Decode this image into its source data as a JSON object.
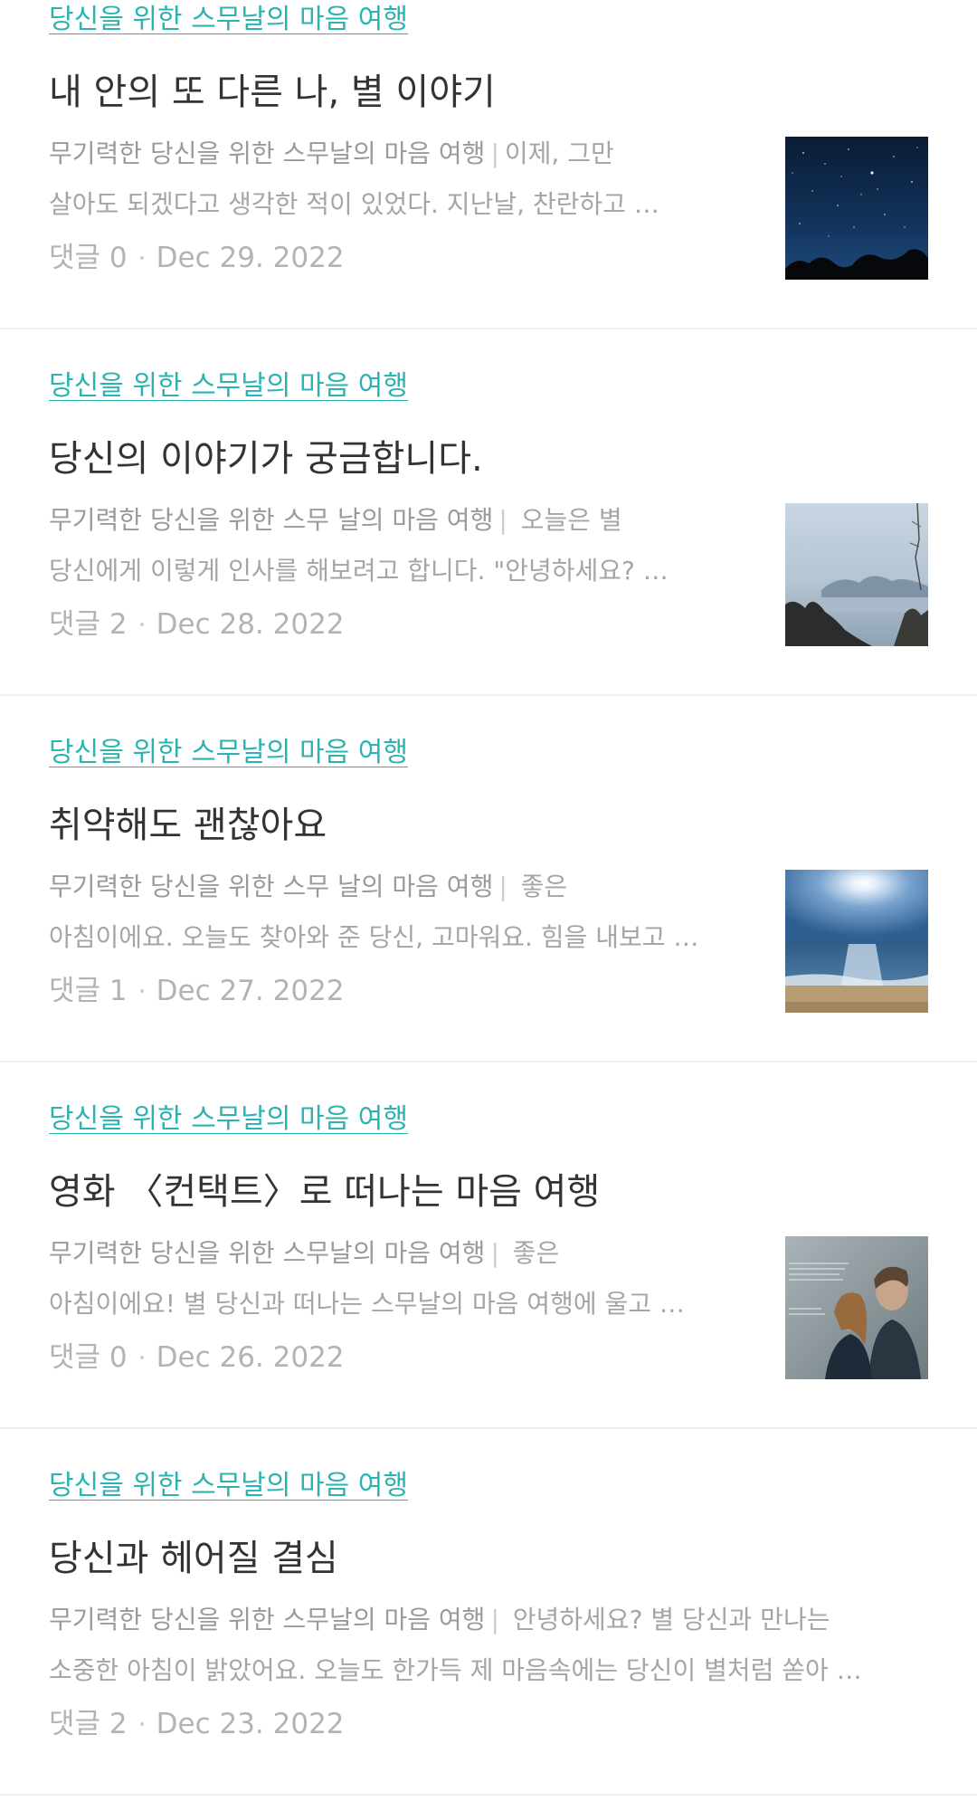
{
  "posts": [
    {
      "category": "당신을 위한 스무날의 마음 여행",
      "title": "내 안의 또 다른 나, 별 이야기",
      "excerpt_lead": "무기력한 당신을 위한 스무날의 마음 여행",
      "excerpt_line1": "이제, 그만",
      "excerpt_line2": "살아도 되겠다고 생각한 적이 있었다.    지난날, 찬란하고 …",
      "comments": "댓글 0",
      "date": "Dec 29. 2022",
      "thumbnail": "starry-night-image"
    },
    {
      "category": "당신을 위한 스무날의 마음 여행",
      "title": "당신의 이야기가 궁금합니다.",
      "excerpt_lead": "무기력한 당신을 위한 스무 날의 마음 여행",
      "excerpt_line1": "오늘은 별",
      "excerpt_line2": "당신에게 이렇게 인사를 해보려고 합니다. \"안녕하세요? …",
      "comments": "댓글 2",
      "date": "Dec 28. 2022",
      "thumbnail": "misty-islands-image"
    },
    {
      "category": "당신을 위한 스무날의 마음 여행",
      "title": "취약해도 괜찮아요",
      "excerpt_lead": "무기력한 당신을 위한 스무 날의 마음 여행",
      "excerpt_line1": "좋은",
      "excerpt_line2": "아침이에요. 오늘도 찾아와 준 당신, 고마워요. 힘을 내보고 …",
      "comments": "댓글 1",
      "date": "Dec 27. 2022",
      "thumbnail": "sunlit-sea-image"
    },
    {
      "category": "당신을 위한 스무날의 마음 여행",
      "title": "영화 〈컨택트〉로 떠나는 마음 여행",
      "excerpt_lead": "무기력한 당신을 위한 스무날의 마음 여행",
      "excerpt_line1": "좋은",
      "excerpt_line2": "아침이에요! 별 당신과 떠나는 스무날의 마음 여행에 울고 …",
      "comments": "댓글 0",
      "date": "Dec 26. 2022",
      "thumbnail": "movie-still-image"
    },
    {
      "category": "당신을 위한 스무날의 마음 여행",
      "title": "당신과 헤어질 결심",
      "excerpt_lead": "무기력한 당신을 위한 스무날의 마음 여행",
      "excerpt_line1": "안녕하세요? 별 당신과 만나는",
      "excerpt_line2": "소중한 아침이 밝았어요. 오늘도 한가득 제 마음속에는 당신이 별처럼 쏟아 …",
      "comments": "댓글 2",
      "date": "Dec 23. 2022",
      "thumbnail": ""
    }
  ]
}
